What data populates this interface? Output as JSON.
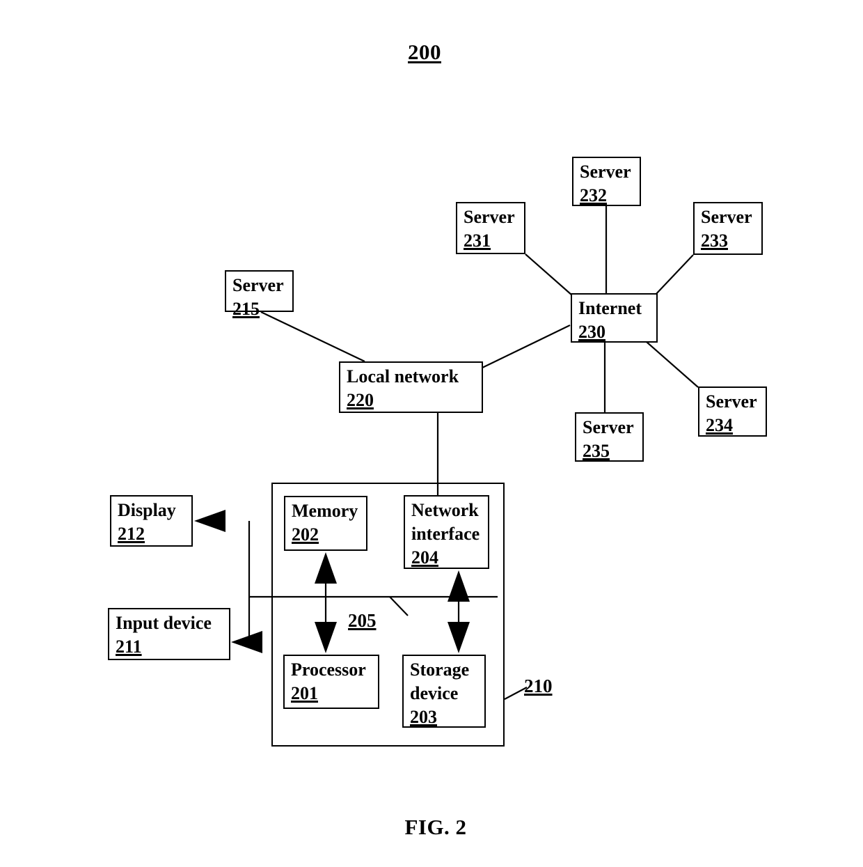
{
  "figure": {
    "number": "200",
    "caption": "FIG. 2"
  },
  "nodes": {
    "server215": {
      "title": "Server",
      "number": "215"
    },
    "server231": {
      "title": "Server",
      "number": "231"
    },
    "server232": {
      "title": "Server",
      "number": "232"
    },
    "server233": {
      "title": "Server",
      "number": "233"
    },
    "server234": {
      "title": "Server",
      "number": "234"
    },
    "server235": {
      "title": "Server",
      "number": "235"
    },
    "internet": {
      "title": "Internet",
      "number": "230"
    },
    "local_network": {
      "title": "Local network",
      "number": "220"
    },
    "memory": {
      "title": "Memory",
      "number": "202"
    },
    "network_interface": {
      "title": "Network interface",
      "number": "204"
    },
    "processor": {
      "title": "Processor",
      "number": "201"
    },
    "storage_device": {
      "title": "Storage device",
      "number": "203"
    },
    "display": {
      "title": "Display",
      "number": "212"
    },
    "input_device": {
      "title": "Input device",
      "number": "211"
    }
  },
  "labels": {
    "bus": "205",
    "computer_system": "210"
  },
  "colors": {
    "line": "#000000",
    "background": "#ffffff"
  }
}
